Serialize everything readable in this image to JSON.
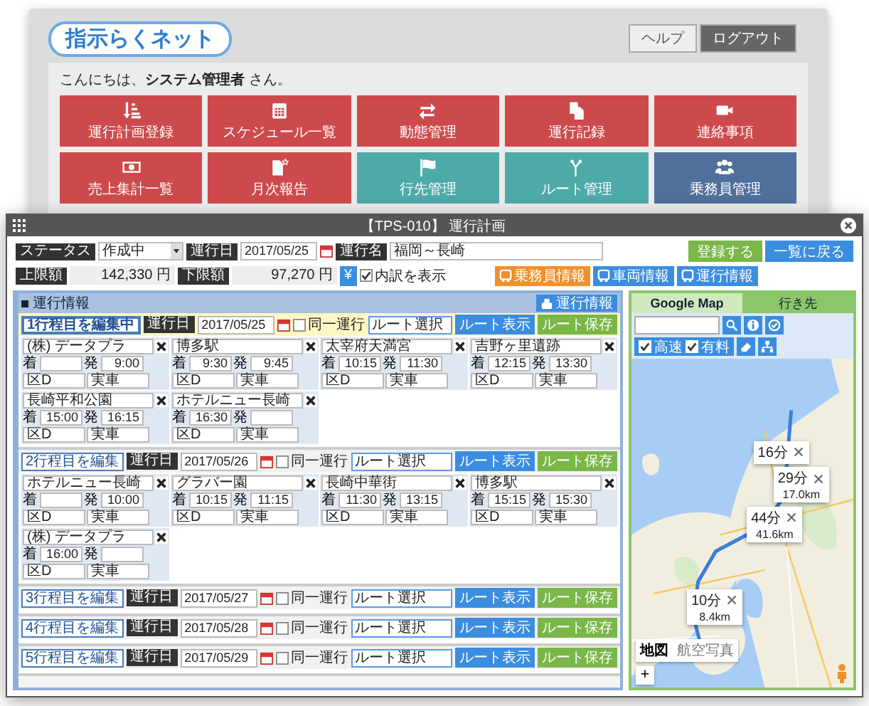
{
  "back_window": {
    "logo": "指示らくネット",
    "buttons": [
      {
        "label": "ヘルプ",
        "kind": "light"
      },
      {
        "label": "ログアウト",
        "kind": "dark"
      }
    ],
    "greeting": "こんにちは、**システム管理者** さん。",
    "tiles": [
      {
        "label": "運行計画登録",
        "color": "#cd4a4c"
      },
      {
        "label": "スケジュール一覧",
        "color": "#cd4a4c"
      },
      {
        "label": "動態管理",
        "color": "#cd4a4c"
      },
      {
        "label": "運行記録",
        "color": "#cd4a4c"
      },
      {
        "label": "連絡事項",
        "color": "#cd4a4c"
      },
      {
        "label": "売上集計一覧",
        "color": "#cd4a4c"
      },
      {
        "label": "月次報告",
        "color": "#cd4a4c"
      },
      {
        "label": "行先管理",
        "color": "#4eaaa8"
      },
      {
        "label": "ルート管理",
        "color": "#4eaaa8"
      },
      {
        "label": "乗務員管理",
        "color": "#50709c"
      }
    ]
  },
  "front_window": {
    "title": "【TPS-010】 運行計画",
    "form": {
      "status_label": "ステータス",
      "status_value": "作成中",
      "date_label": "運行日",
      "date_value": "2017/05/25",
      "name_label": "運行名",
      "name_value": "福岡～長崎",
      "upper_label": "上限額",
      "upper_value": "142,330 円",
      "lower_label": "下限額",
      "lower_value": "97,270 円",
      "yen_button": "¥",
      "breakdown": {
        "label": "内訳を表示",
        "checked": true
      }
    },
    "tool_buttons": [
      {
        "label": "乗務員情報",
        "kind": "orange"
      },
      {
        "label": "車両情報",
        "kind": "blue"
      },
      {
        "label": "運行情報",
        "kind": "blue"
      }
    ],
    "actions": [
      {
        "label": "登録する",
        "kind": "green"
      },
      {
        "label": "一覧に戻る",
        "kind": "blue"
      }
    ],
    "plan": {
      "title": "運行情報",
      "header_button": "運行情報",
      "days": [
        {
          "edit_label": "1行程目を編集中",
          "selected": true,
          "date_label": "運行日",
          "date": "2017/05/25",
          "same_trip": {
            "label": "同一運行",
            "checked": false
          },
          "route": "ルート選択",
          "show_button": "ルート表示",
          "save_button": "ルート保存",
          "stops": [
            {
              "name": "(株) データプラ",
              "arrive_label": "着",
              "depart_label": "発",
              "depart": "9:00",
              "code": "区D",
              "type": "実車"
            },
            {
              "name": "博多駅",
              "arrive_label": "着",
              "arrive": "9:30",
              "depart_label": "発",
              "depart": "9:45",
              "code": "区D",
              "type": "実車"
            },
            {
              "name": "太宰府天満宮",
              "arrive_label": "着",
              "arrive": "10:15",
              "depart_label": "発",
              "depart": "11:30",
              "code": "区D",
              "type": "実車"
            },
            {
              "name": "吉野ヶ里遺跡",
              "arrive_label": "着",
              "arrive": "12:15",
              "depart_label": "発",
              "depart": "13:30",
              "code": "区D",
              "type": "実車"
            },
            {
              "name": "長崎平和公園",
              "arrive_label": "着",
              "arrive": "15:00",
              "depart_label": "発",
              "depart": "16:15",
              "code": "区D",
              "type": "実車"
            },
            {
              "name": "ホテルニュー長崎",
              "arrive_label": "着",
              "arrive": "16:30",
              "depart_label": "発",
              "code": "区D",
              "type": "実車"
            }
          ]
        },
        {
          "edit_label": "2行程目を編集",
          "selected": false,
          "date_label": "運行日",
          "date": "2017/05/26",
          "same_trip": {
            "label": "同一運行",
            "checked": false
          },
          "route": "ルート選択",
          "show_button": "ルート表示",
          "save_button": "ルート保存",
          "stops": [
            {
              "name": "ホテルニュー長崎",
              "arrive_label": "着",
              "depart_label": "発",
              "depart": "10:00",
              "code": "区D",
              "type": "実車"
            },
            {
              "name": "グラバー園",
              "arrive_label": "着",
              "arrive": "10:15",
              "depart_label": "発",
              "depart": "11:15",
              "code": "区D",
              "type": "実車"
            },
            {
              "name": "長崎中華街",
              "arrive_label": "着",
              "arrive": "11:30",
              "depart_label": "発",
              "depart": "13:15",
              "code": "区D",
              "type": "実車"
            },
            {
              "name": "博多駅",
              "arrive_label": "着",
              "arrive": "15:15",
              "depart_label": "発",
              "depart": "15:30",
              "code": "区D",
              "type": "実車"
            },
            {
              "name": "(株) データプラ",
              "arrive_label": "着",
              "arrive": "16:00",
              "depart_label": "発",
              "code": "区D",
              "type": "実車"
            }
          ]
        },
        {
          "edit_label": "3行程目を編集",
          "selected": false,
          "date_label": "運行日",
          "date": "2017/05/27",
          "same_trip": {
            "label": "同一運行",
            "checked": false
          },
          "route": "ルート選択",
          "show_button": "ルート表示",
          "save_button": "ルート保存"
        },
        {
          "edit_label": "4行程目を編集",
          "selected": false,
          "date_label": "運行日",
          "date": "2017/05/28",
          "same_trip": {
            "label": "同一運行",
            "checked": false
          },
          "route": "ルート選択",
          "show_button": "ルート表示",
          "save_button": "ルート保存"
        },
        {
          "edit_label": "5行程目を編集",
          "selected": false,
          "date_label": "運行日",
          "date": "2017/05/29",
          "same_trip": {
            "label": "同一運行",
            "checked": false
          },
          "route": "ルート選択",
          "show_button": "ルート表示",
          "save_button": "ルート保存"
        }
      ]
    },
    "map": {
      "tabs": [
        {
          "label": "Google Map",
          "selected": true
        },
        {
          "label": "行き先",
          "selected": false
        }
      ],
      "toll_options": [
        {
          "label": "高速",
          "checked": true
        },
        {
          "label": "有料",
          "checked": true
        }
      ],
      "callouts": [
        {
          "duration": "16分"
        },
        {
          "duration": "29分",
          "distance": "17.0km"
        },
        {
          "duration": "44分",
          "distance": "41.6km"
        },
        {
          "duration": "10分",
          "distance": "8.4km"
        }
      ],
      "map_type_buttons": [
        {
          "label": "地図",
          "selected": true
        },
        {
          "label": "航空写真",
          "selected": false
        }
      ],
      "zoom_button": "+"
    }
  }
}
